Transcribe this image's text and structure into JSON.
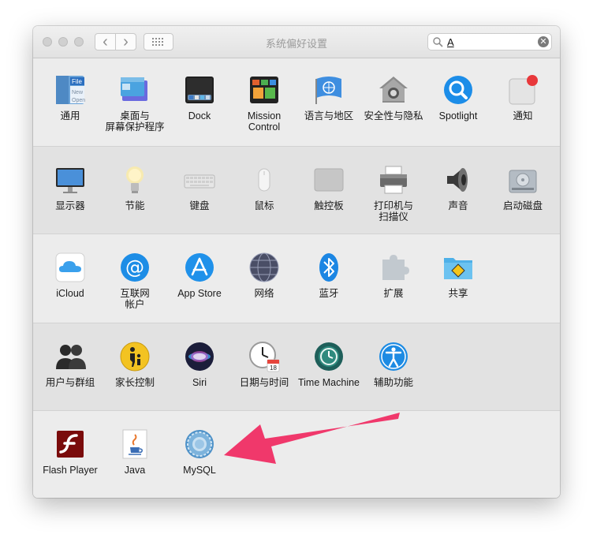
{
  "window": {
    "title": "系统偏好设置"
  },
  "search": {
    "query": "A",
    "clear_glyph": "✕"
  },
  "nav": {
    "back": "‹",
    "forward": "›"
  },
  "rows": [
    [
      {
        "label": "通用",
        "icon": "general-icon"
      },
      {
        "label": "桌面与\n屏幕保护程序",
        "icon": "desktop-icon"
      },
      {
        "label": "Dock",
        "icon": "dock-icon"
      },
      {
        "label": "Mission\nControl",
        "icon": "mission-control-icon"
      },
      {
        "label": "语言与地区",
        "icon": "language-region-icon"
      },
      {
        "label": "安全性与隐私",
        "icon": "security-icon"
      },
      {
        "label": "Spotlight",
        "icon": "spotlight-icon"
      },
      {
        "label": "通知",
        "icon": "notifications-icon"
      }
    ],
    [
      {
        "label": "显示器",
        "icon": "displays-icon"
      },
      {
        "label": "节能",
        "icon": "energy-saver-icon"
      },
      {
        "label": "键盘",
        "icon": "keyboard-icon"
      },
      {
        "label": "鼠标",
        "icon": "mouse-icon"
      },
      {
        "label": "触控板",
        "icon": "trackpad-icon"
      },
      {
        "label": "打印机与\n扫描仪",
        "icon": "printer-icon"
      },
      {
        "label": "声音",
        "icon": "sound-icon"
      },
      {
        "label": "启动磁盘",
        "icon": "startup-disk-icon"
      }
    ],
    [
      {
        "label": "iCloud",
        "icon": "icloud-icon"
      },
      {
        "label": "互联网\n帐户",
        "icon": "internet-accounts-icon"
      },
      {
        "label": "App Store",
        "icon": "app-store-icon"
      },
      {
        "label": "网络",
        "icon": "network-icon"
      },
      {
        "label": "蓝牙",
        "icon": "bluetooth-icon"
      },
      {
        "label": "扩展",
        "icon": "extensions-icon"
      },
      {
        "label": "共享",
        "icon": "sharing-icon"
      }
    ],
    [
      {
        "label": "用户与群组",
        "icon": "users-groups-icon"
      },
      {
        "label": "家长控制",
        "icon": "parental-controls-icon"
      },
      {
        "label": "Siri",
        "icon": "siri-icon"
      },
      {
        "label": "日期与时间",
        "icon": "date-time-icon"
      },
      {
        "label": "Time Machine",
        "icon": "time-machine-icon"
      },
      {
        "label": "辅助功能",
        "icon": "accessibility-icon"
      }
    ],
    [
      {
        "label": "Flash Player",
        "icon": "flash-player-icon"
      },
      {
        "label": "Java",
        "icon": "java-icon"
      },
      {
        "label": "MySQL",
        "icon": "mysql-icon"
      }
    ]
  ],
  "icon_text": {
    "general_file": "File",
    "general_new": "New",
    "general_open": "Open",
    "calendar_day": "18"
  },
  "annotation": {
    "arrow_color": "#f0386b"
  }
}
